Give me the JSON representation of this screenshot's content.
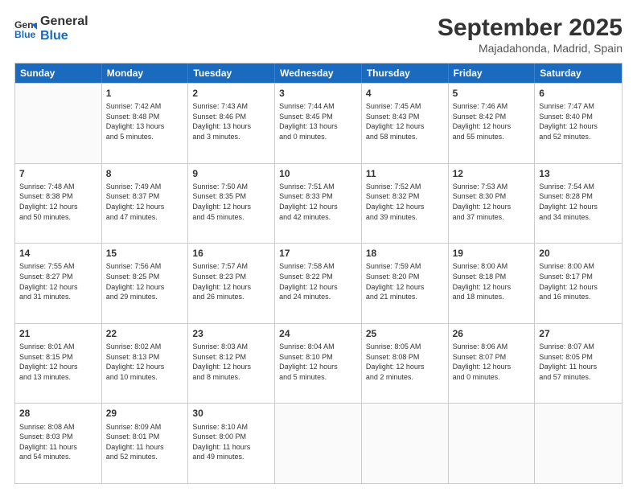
{
  "logo": {
    "line1": "General",
    "line2": "Blue"
  },
  "title": "September 2025",
  "location": "Majadahonda, Madrid, Spain",
  "days_of_week": [
    "Sunday",
    "Monday",
    "Tuesday",
    "Wednesday",
    "Thursday",
    "Friday",
    "Saturday"
  ],
  "weeks": [
    [
      {
        "day": "",
        "info": ""
      },
      {
        "day": "1",
        "info": "Sunrise: 7:42 AM\nSunset: 8:48 PM\nDaylight: 13 hours\nand 5 minutes."
      },
      {
        "day": "2",
        "info": "Sunrise: 7:43 AM\nSunset: 8:46 PM\nDaylight: 13 hours\nand 3 minutes."
      },
      {
        "day": "3",
        "info": "Sunrise: 7:44 AM\nSunset: 8:45 PM\nDaylight: 13 hours\nand 0 minutes."
      },
      {
        "day": "4",
        "info": "Sunrise: 7:45 AM\nSunset: 8:43 PM\nDaylight: 12 hours\nand 58 minutes."
      },
      {
        "day": "5",
        "info": "Sunrise: 7:46 AM\nSunset: 8:42 PM\nDaylight: 12 hours\nand 55 minutes."
      },
      {
        "day": "6",
        "info": "Sunrise: 7:47 AM\nSunset: 8:40 PM\nDaylight: 12 hours\nand 52 minutes."
      }
    ],
    [
      {
        "day": "7",
        "info": "Sunrise: 7:48 AM\nSunset: 8:38 PM\nDaylight: 12 hours\nand 50 minutes."
      },
      {
        "day": "8",
        "info": "Sunrise: 7:49 AM\nSunset: 8:37 PM\nDaylight: 12 hours\nand 47 minutes."
      },
      {
        "day": "9",
        "info": "Sunrise: 7:50 AM\nSunset: 8:35 PM\nDaylight: 12 hours\nand 45 minutes."
      },
      {
        "day": "10",
        "info": "Sunrise: 7:51 AM\nSunset: 8:33 PM\nDaylight: 12 hours\nand 42 minutes."
      },
      {
        "day": "11",
        "info": "Sunrise: 7:52 AM\nSunset: 8:32 PM\nDaylight: 12 hours\nand 39 minutes."
      },
      {
        "day": "12",
        "info": "Sunrise: 7:53 AM\nSunset: 8:30 PM\nDaylight: 12 hours\nand 37 minutes."
      },
      {
        "day": "13",
        "info": "Sunrise: 7:54 AM\nSunset: 8:28 PM\nDaylight: 12 hours\nand 34 minutes."
      }
    ],
    [
      {
        "day": "14",
        "info": "Sunrise: 7:55 AM\nSunset: 8:27 PM\nDaylight: 12 hours\nand 31 minutes."
      },
      {
        "day": "15",
        "info": "Sunrise: 7:56 AM\nSunset: 8:25 PM\nDaylight: 12 hours\nand 29 minutes."
      },
      {
        "day": "16",
        "info": "Sunrise: 7:57 AM\nSunset: 8:23 PM\nDaylight: 12 hours\nand 26 minutes."
      },
      {
        "day": "17",
        "info": "Sunrise: 7:58 AM\nSunset: 8:22 PM\nDaylight: 12 hours\nand 24 minutes."
      },
      {
        "day": "18",
        "info": "Sunrise: 7:59 AM\nSunset: 8:20 PM\nDaylight: 12 hours\nand 21 minutes."
      },
      {
        "day": "19",
        "info": "Sunrise: 8:00 AM\nSunset: 8:18 PM\nDaylight: 12 hours\nand 18 minutes."
      },
      {
        "day": "20",
        "info": "Sunrise: 8:00 AM\nSunset: 8:17 PM\nDaylight: 12 hours\nand 16 minutes."
      }
    ],
    [
      {
        "day": "21",
        "info": "Sunrise: 8:01 AM\nSunset: 8:15 PM\nDaylight: 12 hours\nand 13 minutes."
      },
      {
        "day": "22",
        "info": "Sunrise: 8:02 AM\nSunset: 8:13 PM\nDaylight: 12 hours\nand 10 minutes."
      },
      {
        "day": "23",
        "info": "Sunrise: 8:03 AM\nSunset: 8:12 PM\nDaylight: 12 hours\nand 8 minutes."
      },
      {
        "day": "24",
        "info": "Sunrise: 8:04 AM\nSunset: 8:10 PM\nDaylight: 12 hours\nand 5 minutes."
      },
      {
        "day": "25",
        "info": "Sunrise: 8:05 AM\nSunset: 8:08 PM\nDaylight: 12 hours\nand 2 minutes."
      },
      {
        "day": "26",
        "info": "Sunrise: 8:06 AM\nSunset: 8:07 PM\nDaylight: 12 hours\nand 0 minutes."
      },
      {
        "day": "27",
        "info": "Sunrise: 8:07 AM\nSunset: 8:05 PM\nDaylight: 11 hours\nand 57 minutes."
      }
    ],
    [
      {
        "day": "28",
        "info": "Sunrise: 8:08 AM\nSunset: 8:03 PM\nDaylight: 11 hours\nand 54 minutes."
      },
      {
        "day": "29",
        "info": "Sunrise: 8:09 AM\nSunset: 8:01 PM\nDaylight: 11 hours\nand 52 minutes."
      },
      {
        "day": "30",
        "info": "Sunrise: 8:10 AM\nSunset: 8:00 PM\nDaylight: 11 hours\nand 49 minutes."
      },
      {
        "day": "",
        "info": ""
      },
      {
        "day": "",
        "info": ""
      },
      {
        "day": "",
        "info": ""
      },
      {
        "day": "",
        "info": ""
      }
    ]
  ]
}
